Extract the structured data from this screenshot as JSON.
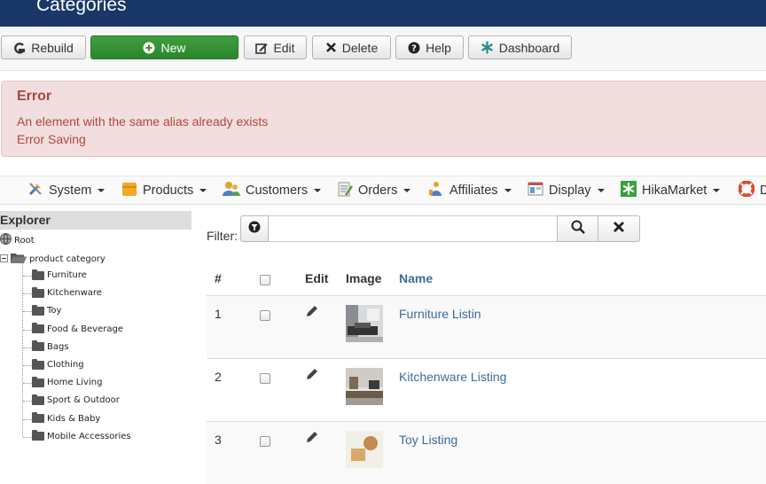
{
  "header": {
    "title": "Categories"
  },
  "toolbar": {
    "rebuild": "Rebuild",
    "new": "New",
    "edit": "Edit",
    "delete": "Delete",
    "help": "Help",
    "dashboard": "Dashboard"
  },
  "alert": {
    "heading": "Error",
    "messages": [
      "An element with the same alias already exists",
      "Error Saving"
    ]
  },
  "menu": {
    "items": [
      "System",
      "Products",
      "Customers",
      "Orders",
      "Affiliates",
      "Display",
      "HikaMarket",
      "D"
    ]
  },
  "explorer": {
    "title": "Explorer",
    "root": "Root",
    "parent": "product category",
    "children": [
      "Furniture",
      "Kitchenware",
      "Toy",
      "Food & Beverage",
      "Bags",
      "Clothing",
      "Home Living",
      "Sport & Outdoor",
      "Kids & Baby",
      "Mobile Accessories"
    ]
  },
  "filter": {
    "label": "Filter:",
    "value": ""
  },
  "table": {
    "headers": {
      "num": "#",
      "edit": "Edit",
      "image": "Image",
      "name": "Name"
    },
    "rows": [
      {
        "num": "1",
        "name": "Furniture Listin"
      },
      {
        "num": "2",
        "name": "Kitchenware Listing"
      },
      {
        "num": "3",
        "name": "Toy Listing"
      }
    ]
  },
  "colors": {
    "header_bg": "#1a3867",
    "new_button": "#339933",
    "alert_bg": "#f2dede",
    "alert_text": "#a94442",
    "link": "#3b6c9b"
  }
}
